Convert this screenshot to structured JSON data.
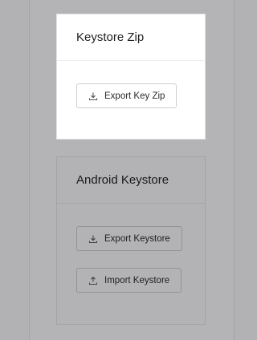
{
  "keystore_zip": {
    "title": "Keystore Zip",
    "export_button": {
      "label": "Export Key Zip",
      "icon": "download-icon"
    }
  },
  "android_keystore": {
    "title": "Android Keystore",
    "export_button": {
      "label": "Export Keystore",
      "icon": "download-icon"
    },
    "import_button": {
      "label": "Import Keystore",
      "icon": "upload-icon"
    }
  },
  "colors": {
    "overlay": "#b2b2b4",
    "card_highlight": "#ffffff",
    "text": "#1f1f21"
  }
}
